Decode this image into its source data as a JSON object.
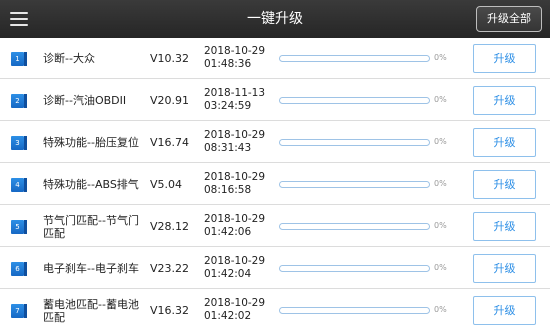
{
  "header": {
    "title": "一键升级",
    "upgrade_all_label": "升级全部"
  },
  "items": [
    {
      "num": "1",
      "name": "诊断--大众",
      "version": "V10.32",
      "date": "2018-10-29",
      "time": "01:48:36",
      "progress": 0,
      "progress_label": "0%",
      "button": "升级"
    },
    {
      "num": "2",
      "name": "诊断--汽油OBDII",
      "version": "V20.91",
      "date": "2018-11-13",
      "time": "03:24:59",
      "progress": 0,
      "progress_label": "0%",
      "button": "升级"
    },
    {
      "num": "3",
      "name": "特殊功能--胎压复位",
      "version": "V16.74",
      "date": "2018-10-29",
      "time": "08:31:43",
      "progress": 0,
      "progress_label": "0%",
      "button": "升级"
    },
    {
      "num": "4",
      "name": "特殊功能--ABS排气",
      "version": "V5.04",
      "date": "2018-10-29",
      "time": "08:16:58",
      "progress": 0,
      "progress_label": "0%",
      "button": "升级"
    },
    {
      "num": "5",
      "name": "节气门匹配--节气门匹配",
      "version": "V28.12",
      "date": "2018-10-29",
      "time": "01:42:06",
      "progress": 0,
      "progress_label": "0%",
      "button": "升级"
    },
    {
      "num": "6",
      "name": "电子刹车--电子刹车",
      "version": "V23.22",
      "date": "2018-10-29",
      "time": "01:42:04",
      "progress": 0,
      "progress_label": "0%",
      "button": "升级"
    },
    {
      "num": "7",
      "name": "蓄电池匹配--蓄电池匹配",
      "version": "V16.32",
      "date": "2018-10-29",
      "time": "01:42:02",
      "progress": 0,
      "progress_label": "0%",
      "button": "升级"
    }
  ],
  "colors": {
    "accent": "#2d8fe6",
    "header_bg": "#2e2e2e"
  },
  "icons": {
    "menu": "hamburger-menu-icon",
    "item_badge": "numbered-badge-icon"
  }
}
